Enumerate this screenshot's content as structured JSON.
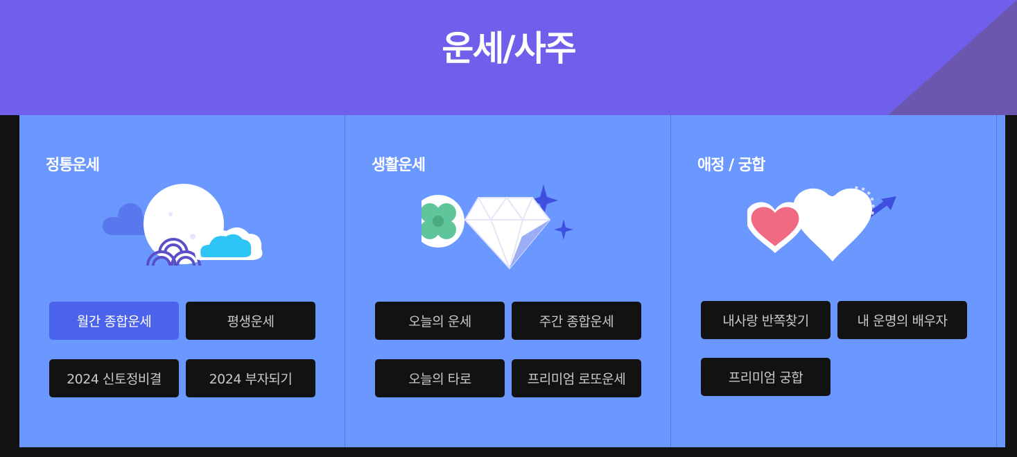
{
  "header": {
    "title": "운세/사주"
  },
  "columns": [
    {
      "title": "정통운세",
      "illustration": "moon-waves-cloud",
      "buttons": [
        {
          "label": "월간 종합운세",
          "active": true
        },
        {
          "label": "평생운세",
          "active": false
        },
        {
          "label": "2024 신토정비결",
          "active": false
        },
        {
          "label": "2024 부자되기",
          "active": false
        }
      ]
    },
    {
      "title": "생활운세",
      "illustration": "diamond-clover-sparkle",
      "buttons": [
        {
          "label": "오늘의 운세",
          "active": false
        },
        {
          "label": "주간 종합운세",
          "active": false
        },
        {
          "label": "오늘의 타로",
          "active": false
        },
        {
          "label": "프리미엄 로또운세",
          "active": false
        }
      ]
    },
    {
      "title": "애정 / 궁합",
      "illustration": "hearts-arrow",
      "buttons": [
        {
          "label": "내사랑 반쪽찾기",
          "active": false
        },
        {
          "label": "내 운명의 배우자",
          "active": false
        },
        {
          "label": "프리미엄 궁합",
          "active": false
        }
      ]
    }
  ],
  "colors": {
    "header_bg": "#6f5fea",
    "panel_bg": "#6a98ff",
    "button_bg": "#121212",
    "button_active_bg": "#4b63ea"
  }
}
